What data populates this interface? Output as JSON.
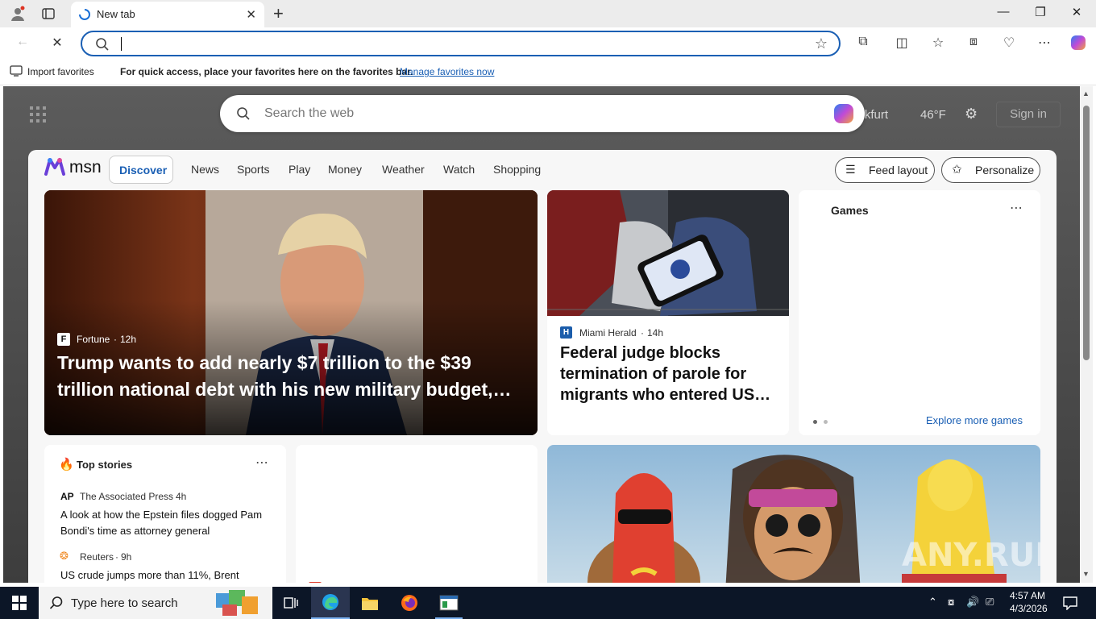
{
  "browser": {
    "tab_title": "New tab",
    "favorites_bar": {
      "import_label": "Import favorites",
      "hint": "For quick access, place your favorites here on the favorites bar.",
      "manage_link": "Manage favorites now"
    }
  },
  "newtab": {
    "search_placeholder": "Search the web",
    "location": "Frankfurt",
    "temperature": "46°F",
    "signin_label": "Sign in"
  },
  "msn": {
    "logo_text": "msn",
    "nav": [
      "Discover",
      "News",
      "Sports",
      "Play",
      "Money",
      "Weather",
      "Watch",
      "Shopping"
    ],
    "feed_layout_label": "Feed layout",
    "personalize_label": "Personalize",
    "hero": {
      "source": "Fortune",
      "age": "12h",
      "headline": "Trump wants to add nearly $7 trillion to the $39 trillion national debt with his new military budget,…"
    },
    "story2": {
      "source": "Miami Herald",
      "age": "14h",
      "headline": "Federal judge blocks termination of parole for migrants who entered US…"
    },
    "games": {
      "title": "Games",
      "explore_link": "Explore more games"
    },
    "top_stories": {
      "title": "Top stories",
      "items": [
        {
          "source": "The Associated Press",
          "age": "4h",
          "headline": "A look at how the Epstein files dogged Pam Bondi's time as attorney general"
        },
        {
          "source": "Reuters",
          "age": "9h",
          "headline": "US crude jumps more than 11%, Brent"
        }
      ]
    }
  },
  "taskbar": {
    "search_placeholder": "Type here to search",
    "time": "4:57 AM",
    "date": "4/3/2026"
  },
  "watermark": "ANY.RUN"
}
